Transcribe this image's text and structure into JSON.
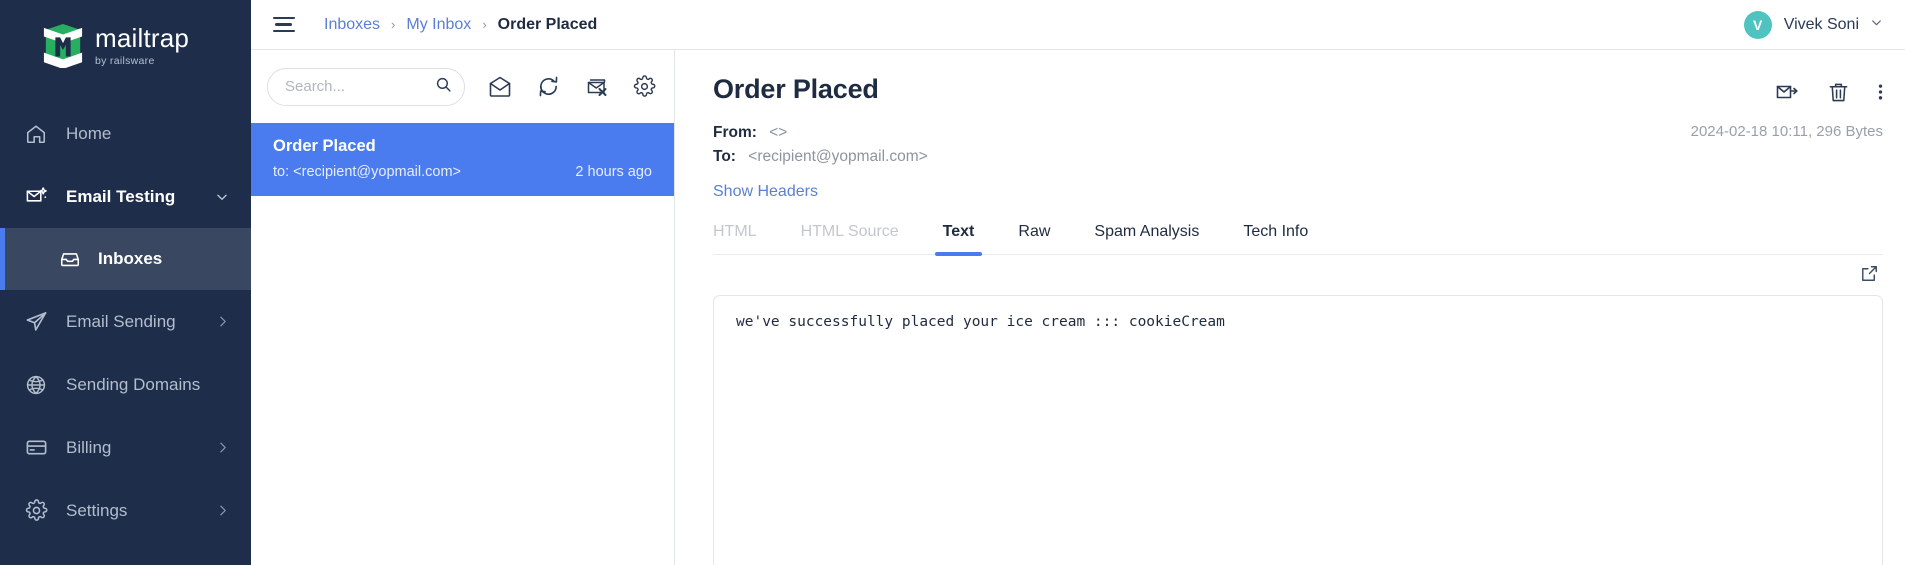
{
  "brand": {
    "name": "mailtrap",
    "tagline": "by railsware",
    "logo_icon": "mailtrap-logo-icon",
    "green": "#27ae60",
    "sidebar_bg": "#1d2d4a",
    "accent_blue": "#4a7cf0"
  },
  "sidebar": {
    "items": [
      {
        "label": "Home",
        "icon": "home-icon",
        "chevron": "",
        "state": "normal"
      },
      {
        "label": "Email Testing",
        "icon": "email-testing-icon",
        "chevron": "⌄",
        "state": "expanded"
      },
      {
        "label": "Inboxes",
        "icon": "inbox-icon",
        "chevron": "",
        "state": "active"
      },
      {
        "label": "Email Sending",
        "icon": "paper-plane-icon",
        "chevron": "›",
        "state": "normal"
      },
      {
        "label": "Sending Domains",
        "icon": "globe-icon",
        "chevron": "",
        "state": "normal"
      },
      {
        "label": "Billing",
        "icon": "credit-card-icon",
        "chevron": "›",
        "state": "normal"
      },
      {
        "label": "Settings",
        "icon": "gear-icon",
        "chevron": "›",
        "state": "normal"
      }
    ]
  },
  "topbar": {
    "menu_icon": "hamburger-icon",
    "breadcrumb": [
      {
        "label": "Inboxes",
        "type": "link"
      },
      {
        "label": "My Inbox",
        "type": "link"
      },
      {
        "label": "Order Placed",
        "type": "current"
      }
    ],
    "separator": "›",
    "user": {
      "initial": "V",
      "name": "Vivek Soni",
      "chevron": "⌄",
      "avatar_color": "#4fc3c0"
    }
  },
  "list_panel": {
    "search": {
      "placeholder": "Search...",
      "value": "",
      "icon": "search-icon"
    },
    "tools": [
      {
        "name": "mark-all-read-icon",
        "title": "Mark all as read"
      },
      {
        "name": "refresh-icon",
        "title": "Refresh"
      },
      {
        "name": "delete-all-icon",
        "title": "Delete all"
      },
      {
        "name": "inbox-settings-icon",
        "title": "Settings"
      }
    ],
    "messages": [
      {
        "subject": "Order Placed",
        "to": "to: <recipient@yopmail.com>",
        "time": "2 hours ago",
        "selected": true
      }
    ]
  },
  "message": {
    "title": "Order Placed",
    "actions": [
      {
        "name": "mark-as-read-icon",
        "title": "Mark as read"
      },
      {
        "name": "trash-icon",
        "title": "Delete"
      },
      {
        "name": "more-options-icon",
        "title": "More"
      }
    ],
    "from_label": "From:",
    "from_value": "<>",
    "to_label": "To:",
    "to_value": "<recipient@yopmail.com>",
    "meta_info": "2024-02-18 10:11, 296 Bytes",
    "show_headers": "Show Headers",
    "tabs": [
      {
        "label": "HTML",
        "state": "disabled"
      },
      {
        "label": "HTML Source",
        "state": "disabled"
      },
      {
        "label": "Text",
        "state": "active"
      },
      {
        "label": "Raw",
        "state": "normal"
      },
      {
        "label": "Spam Analysis",
        "state": "normal"
      },
      {
        "label": "Tech Info",
        "state": "normal"
      }
    ],
    "expand_icon": "open-in-new-icon",
    "body_text": "we've successfully placed your ice cream ::: cookieCream"
  }
}
